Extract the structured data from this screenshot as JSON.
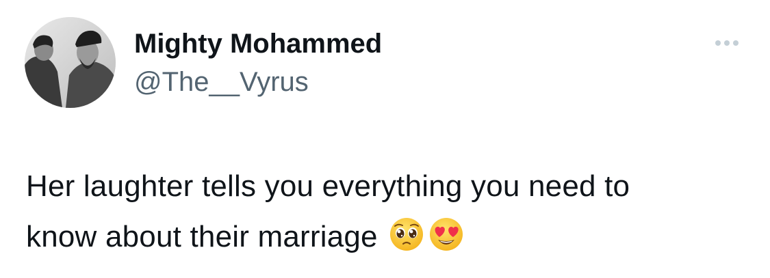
{
  "tweet": {
    "author": {
      "display_name": "Mighty Mohammed",
      "handle": "@The__Vyrus",
      "avatar_icon": "profile-photo-two-men-bw"
    },
    "more_icon": "more-horizontal-icon",
    "text_line_1": "Her laughter tells you everything you need to",
    "text_line_2": "know about their marriage",
    "emojis": [
      "pleading-face-emoji",
      "heart-eyes-emoji"
    ]
  },
  "colors": {
    "name": "#0f1419",
    "handle": "#536471",
    "more_dots": "#c4cfd6",
    "background": "#ffffff"
  }
}
